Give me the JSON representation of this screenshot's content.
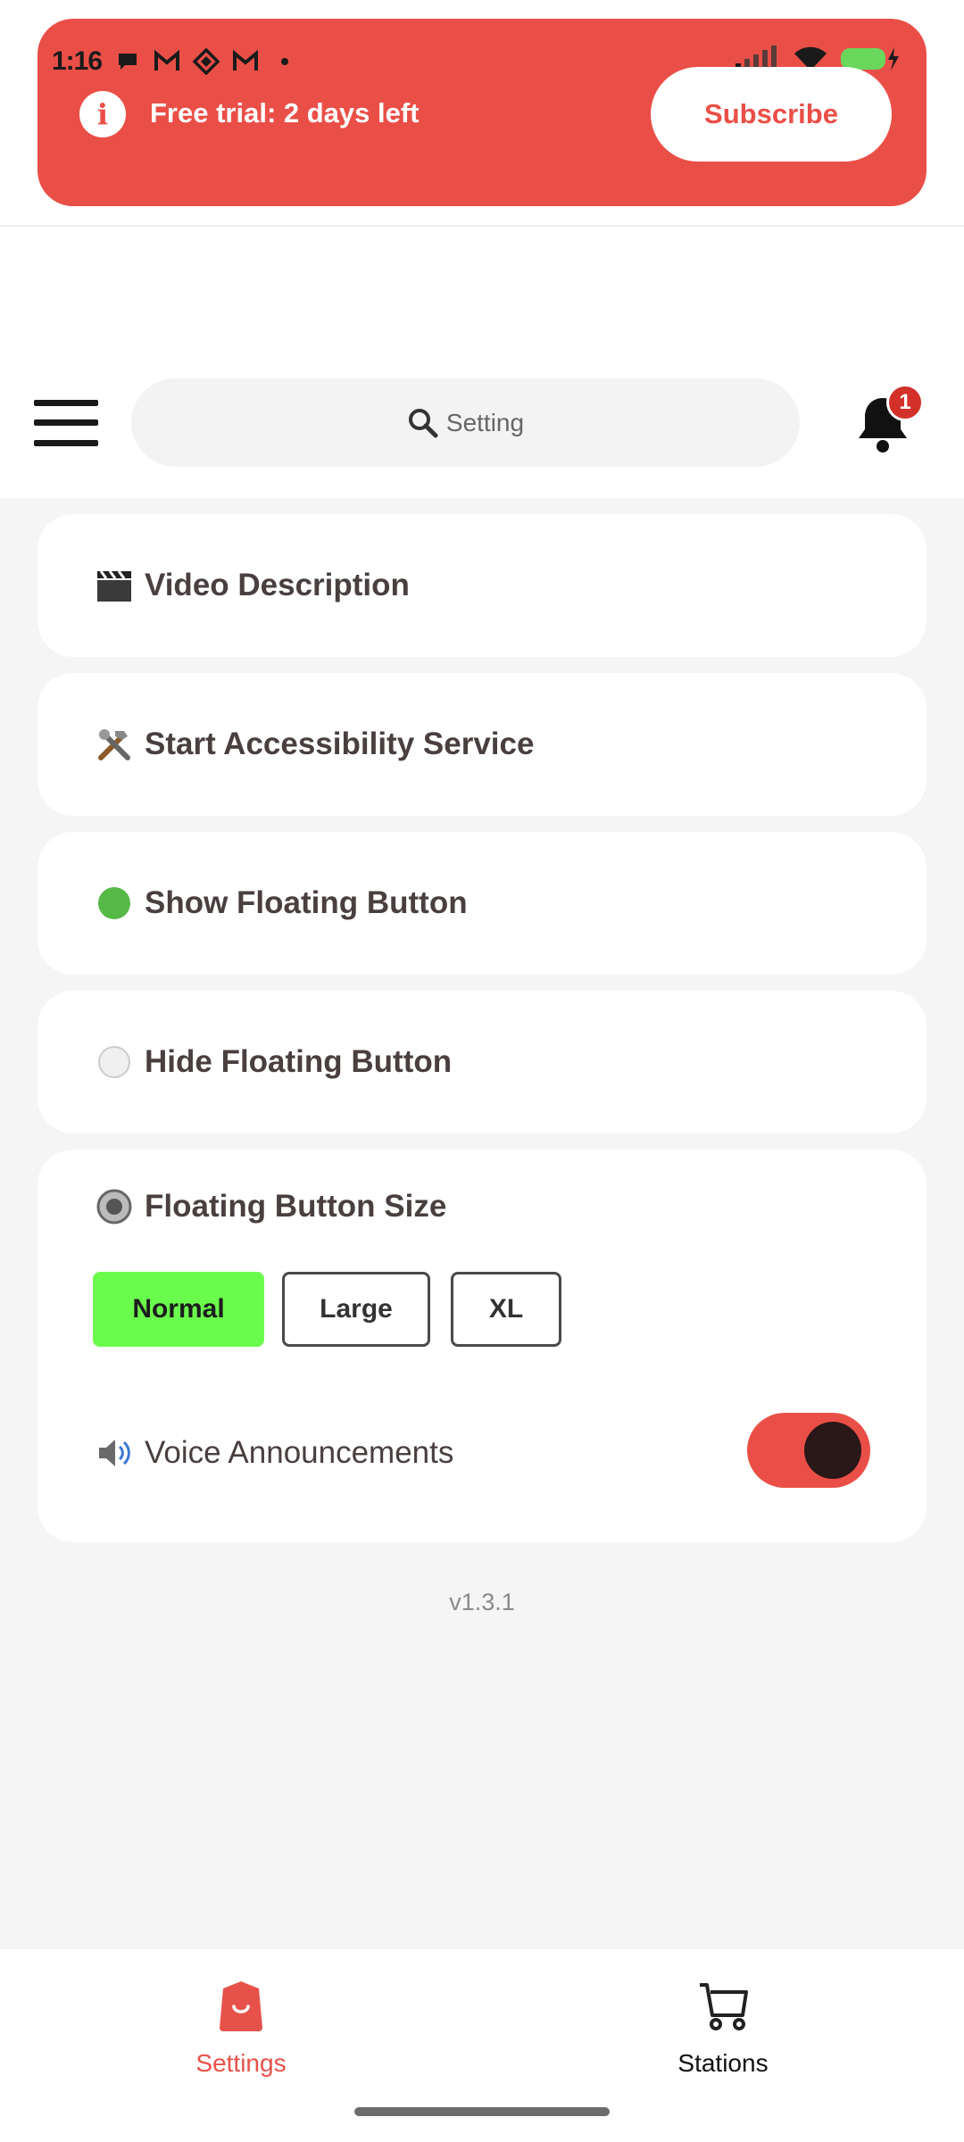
{
  "status_bar": {
    "time": "1:16"
  },
  "banner": {
    "message": "Free trial: 2 days left",
    "subscribe_label": "Subscribe",
    "accent": "#ea4f47"
  },
  "header": {
    "search_placeholder": "Setting",
    "notification_count": "1"
  },
  "menu": [
    {
      "icon": "clapper-icon",
      "label": "Video Description"
    },
    {
      "icon": "tools-icon",
      "label": "Start Accessibility Service"
    },
    {
      "icon": "green-circle-icon",
      "label": "Show Floating Button"
    },
    {
      "icon": "white-circle-icon",
      "label": "Hide Floating Button"
    }
  ],
  "size_section": {
    "icon": "radio-button-icon",
    "title": "Floating Button Size",
    "options": [
      "Normal",
      "Large",
      "XL"
    ],
    "selected": "Normal",
    "selected_color": "#6afc4c"
  },
  "voice": {
    "icon": "speaker-icon",
    "label": "Voice Announcements",
    "enabled": true
  },
  "version": "v1.3.1",
  "bottom_nav": {
    "items": [
      {
        "label": "Settings",
        "icon": "shopping-bag-icon",
        "active": true
      },
      {
        "label": "Stations",
        "icon": "cart-icon",
        "active": false
      }
    ]
  }
}
